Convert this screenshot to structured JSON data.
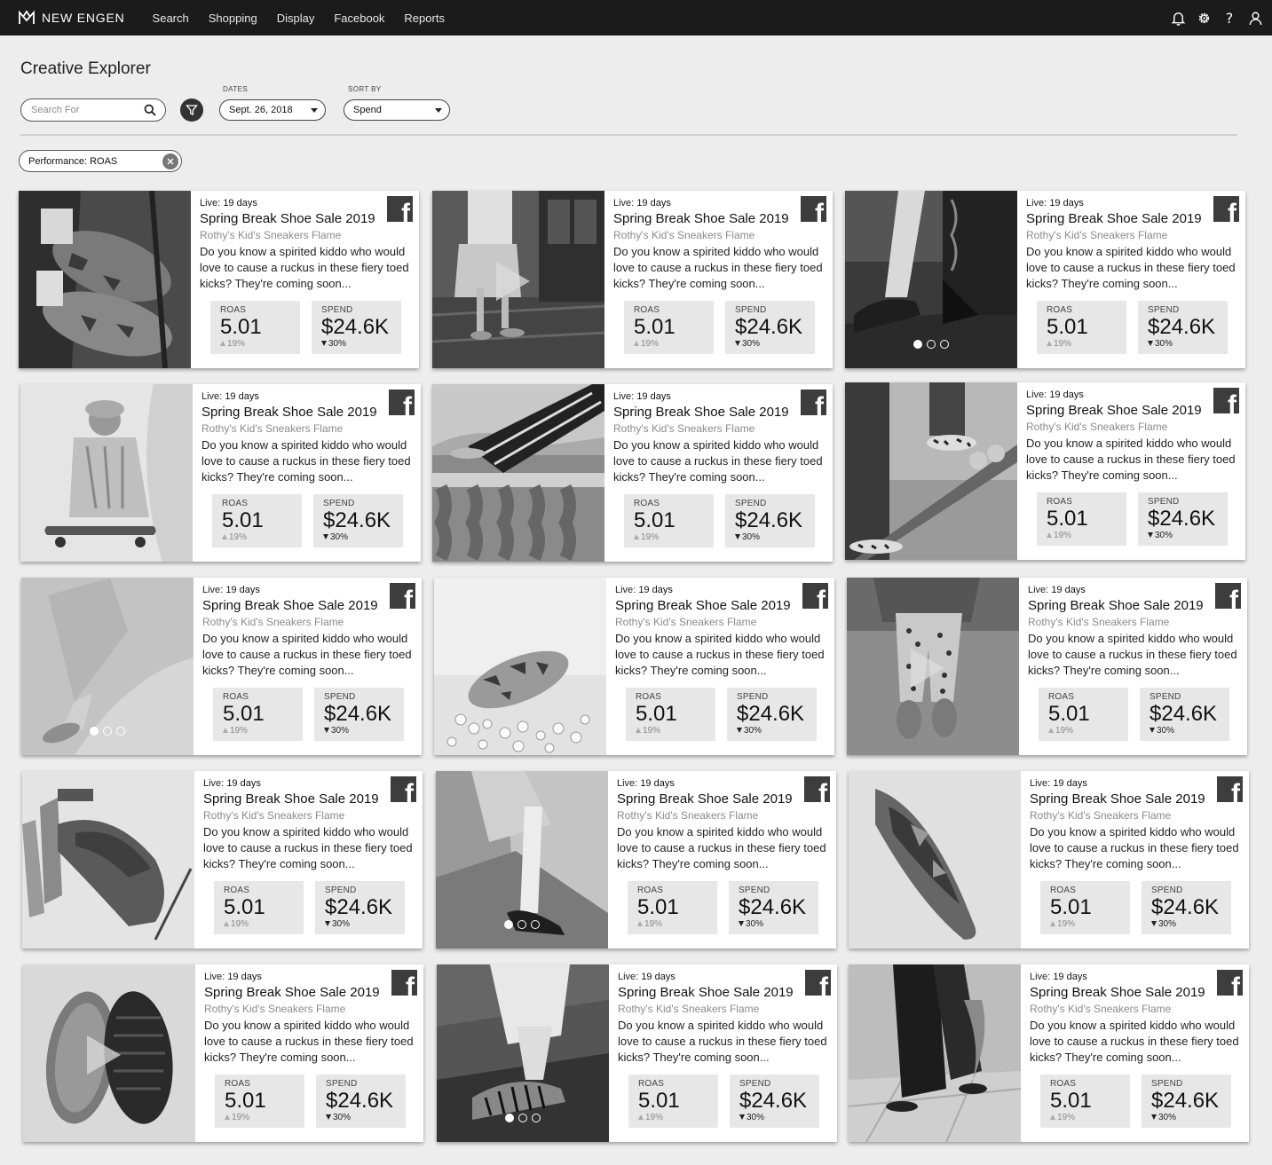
{
  "nav": {
    "brand": "NEW ENGEN",
    "links": [
      "Search",
      "Shopping",
      "Display",
      "Facebook",
      "Reports"
    ],
    "icons": [
      "bell-icon",
      "gear-icon",
      "help-icon",
      "user-icon"
    ],
    "help_glyph": "?"
  },
  "page": {
    "title": "Creative Explorer",
    "search_placeholder": "Search For",
    "dates_label": "DATES",
    "dates_value": "Sept. 26, 2018",
    "sort_label": "SORT BY",
    "sort_value": "Spend",
    "filter_chip": "Performance: ROAS"
  },
  "cards": [
    {
      "live_label": "Live:",
      "live_value": "19 days",
      "title": "Spring Break Shoe Sale 2019",
      "subtitle": "Rothy's Kid's Sneakers Flame",
      "description": "Do you know a spirited kiddo who would love to cause a ruckus in these fiery toed kicks? They're coming soon...",
      "roas_label": "ROAS",
      "roas": "5.01",
      "roas_delta": "19%",
      "spend_label": "SPEND",
      "spend": "$24.6K",
      "spend_delta": "30%",
      "media": "image",
      "scene": 0
    },
    {
      "live_label": "Live:",
      "live_value": "19 days",
      "title": "Spring Break Shoe Sale 2019",
      "subtitle": "Rothy's Kid's Sneakers Flame",
      "description": "Do you know a spirited kiddo who would love to cause a ruckus in these fiery toed kicks? They're coming soon...",
      "roas_label": "ROAS",
      "roas": "5.01",
      "roas_delta": "19%",
      "spend_label": "SPEND",
      "spend": "$24.6K",
      "spend_delta": "30%",
      "media": "video",
      "scene": 1
    },
    {
      "live_label": "Live:",
      "live_value": "19 days",
      "title": "Spring Break Shoe Sale 2019",
      "subtitle": "Rothy's Kid's Sneakers Flame",
      "description": "Do you know a spirited kiddo who would love to cause a ruckus in these fiery toed kicks? They're coming soon...",
      "roas_label": "ROAS",
      "roas": "5.01",
      "roas_delta": "19%",
      "spend_label": "SPEND",
      "spend": "$24.6K",
      "spend_delta": "30%",
      "media": "carousel",
      "scene": 2
    },
    {
      "live_label": "Live:",
      "live_value": "19 days",
      "title": "Spring Break Shoe Sale 2019",
      "subtitle": "Rothy's Kid's Sneakers Flame",
      "description": "Do you know a spirited kiddo who would love to cause a ruckus in these fiery toed kicks? They're coming soon...",
      "roas_label": "ROAS",
      "roas": "5.01",
      "roas_delta": "19%",
      "spend_label": "SPEND",
      "spend": "$24.6K",
      "spend_delta": "30%",
      "media": "image",
      "scene": 3
    },
    {
      "live_label": "Live:",
      "live_value": "19 days",
      "title": "Spring Break Shoe Sale 2019",
      "subtitle": "Rothy's Kid's Sneakers Flame",
      "description": "Do you know a spirited kiddo who would love to cause a ruckus in these fiery toed kicks? They're coming soon...",
      "roas_label": "ROAS",
      "roas": "5.01",
      "roas_delta": "19%",
      "spend_label": "SPEND",
      "spend": "$24.6K",
      "spend_delta": "30%",
      "media": "image",
      "scene": 4
    },
    {
      "live_label": "Live:",
      "live_value": "19 days",
      "title": "Spring Break Shoe Sale 2019",
      "subtitle": "Rothy's Kid's Sneakers Flame",
      "description": "Do you know a spirited kiddo who would love to cause a ruckus in these fiery toed kicks? They're coming soon...",
      "roas_label": "ROAS",
      "roas": "5.01",
      "roas_delta": "19%",
      "spend_label": "SPEND",
      "spend": "$24.6K",
      "spend_delta": "30%",
      "media": "image",
      "scene": 5
    },
    {
      "live_label": "Live:",
      "live_value": "19 days",
      "title": "Spring Break Shoe Sale 2019",
      "subtitle": "Rothy's Kid's Sneakers Flame",
      "description": "Do you know a spirited kiddo who would love to cause a ruckus in these fiery toed kicks? They're coming soon...",
      "roas_label": "ROAS",
      "roas": "5.01",
      "roas_delta": "19%",
      "spend_label": "SPEND",
      "spend": "$24.6K",
      "spend_delta": "30%",
      "media": "carousel",
      "scene": 6
    },
    {
      "live_label": "Live:",
      "live_value": "19 days",
      "title": "Spring Break Shoe Sale 2019",
      "subtitle": "Rothy's Kid's Sneakers Flame",
      "description": "Do you know a spirited kiddo who would love to cause a ruckus in these fiery toed kicks? They're coming soon...",
      "roas_label": "ROAS",
      "roas": "5.01",
      "roas_delta": "19%",
      "spend_label": "SPEND",
      "spend": "$24.6K",
      "spend_delta": "30%",
      "media": "image",
      "scene": 7
    },
    {
      "live_label": "Live:",
      "live_value": "19 days",
      "title": "Spring Break Shoe Sale 2019",
      "subtitle": "Rothy's Kid's Sneakers Flame",
      "description": "Do you know a spirited kiddo who would love to cause a ruckus in these fiery toed kicks? They're coming soon...",
      "roas_label": "ROAS",
      "roas": "5.01",
      "roas_delta": "19%",
      "spend_label": "SPEND",
      "spend": "$24.6K",
      "spend_delta": "30%",
      "media": "video",
      "scene": 8
    },
    {
      "live_label": "Live:",
      "live_value": "19 days",
      "title": "Spring Break Shoe Sale 2019",
      "subtitle": "Rothy's Kid's Sneakers Flame",
      "description": "Do you know a spirited kiddo who would love to cause a ruckus in these fiery toed kicks? They're coming soon...",
      "roas_label": "ROAS",
      "roas": "5.01",
      "roas_delta": "19%",
      "spend_label": "SPEND",
      "spend": "$24.6K",
      "spend_delta": "30%",
      "media": "image",
      "scene": 9
    },
    {
      "live_label": "Live:",
      "live_value": "19 days",
      "title": "Spring Break Shoe Sale 2019",
      "subtitle": "Rothy's Kid's Sneakers Flame",
      "description": "Do you know a spirited kiddo who would love to cause a ruckus in these fiery toed kicks? They're coming soon...",
      "roas_label": "ROAS",
      "roas": "5.01",
      "roas_delta": "19%",
      "spend_label": "SPEND",
      "spend": "$24.6K",
      "spend_delta": "30%",
      "media": "carousel",
      "scene": 10
    },
    {
      "live_label": "Live:",
      "live_value": "19 days",
      "title": "Spring Break Shoe Sale 2019",
      "subtitle": "Rothy's Kid's Sneakers Flame",
      "description": "Do you know a spirited kiddo who would love to cause a ruckus in these fiery toed kicks? They're coming soon...",
      "roas_label": "ROAS",
      "roas": "5.01",
      "roas_delta": "19%",
      "spend_label": "SPEND",
      "spend": "$24.6K",
      "spend_delta": "30%",
      "media": "image",
      "scene": 11
    },
    {
      "live_label": "Live:",
      "live_value": "19 days",
      "title": "Spring Break Shoe Sale 2019",
      "subtitle": "Rothy's Kid's Sneakers Flame",
      "description": "Do you know a spirited kiddo who would love to cause a ruckus in these fiery toed kicks? They're coming soon...",
      "roas_label": "ROAS",
      "roas": "5.01",
      "roas_delta": "19%",
      "spend_label": "SPEND",
      "spend": "$24.6K",
      "spend_delta": "30%",
      "media": "video",
      "scene": 12
    },
    {
      "live_label": "Live:",
      "live_value": "19 days",
      "title": "Spring Break Shoe Sale 2019",
      "subtitle": "Rothy's Kid's Sneakers Flame",
      "description": "Do you know a spirited kiddo who would love to cause a ruckus in these fiery toed kicks? They're coming soon...",
      "roas_label": "ROAS",
      "roas": "5.01",
      "roas_delta": "19%",
      "spend_label": "SPEND",
      "spend": "$24.6K",
      "spend_delta": "30%",
      "media": "carousel",
      "scene": 13
    },
    {
      "live_label": "Live:",
      "live_value": "19 days",
      "title": "Spring Break Shoe Sale 2019",
      "subtitle": "Rothy's Kid's Sneakers Flame",
      "description": "Do you know a spirited kiddo who would love to cause a ruckus in these fiery toed kicks? They're coming soon...",
      "roas_label": "ROAS",
      "roas": "5.01",
      "roas_delta": "19%",
      "spend_label": "SPEND",
      "spend": "$24.6K",
      "spend_delta": "30%",
      "media": "image",
      "scene": 14
    }
  ]
}
